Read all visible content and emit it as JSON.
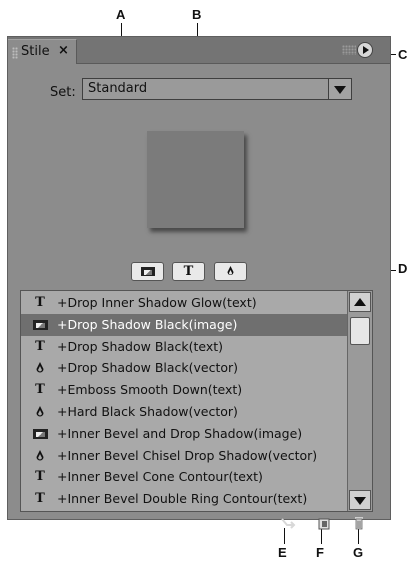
{
  "callouts": {
    "a": "A",
    "b": "B",
    "c": "C",
    "d": "D",
    "e": "E",
    "f": "F",
    "g": "G"
  },
  "panel": {
    "tab_title": "Stile",
    "tab_close": "×",
    "menu_icon": "panel-menu-icon"
  },
  "set": {
    "label": "Set:",
    "value": "Standard"
  },
  "filter_buttons": [
    {
      "icon": "image-filter-icon"
    },
    {
      "icon": "text-filter-icon",
      "glyph": "T"
    },
    {
      "icon": "vector-filter-icon"
    }
  ],
  "styles_list": [
    {
      "type": "text",
      "glyph": "T",
      "label": "+Drop Inner Shadow Glow(text)",
      "selected": false
    },
    {
      "type": "image",
      "label": "+Drop Shadow Black(image)",
      "selected": true
    },
    {
      "type": "text",
      "glyph": "T",
      "label": "+Drop Shadow Black(text)",
      "selected": false
    },
    {
      "type": "vector",
      "label": "+Drop Shadow Black(vector)",
      "selected": false
    },
    {
      "type": "text",
      "glyph": "T",
      "label": "+Emboss Smooth Down(text)",
      "selected": false
    },
    {
      "type": "vector",
      "label": "+Hard Black Shadow(vector)",
      "selected": false
    },
    {
      "type": "image",
      "label": "+Inner Bevel and Drop Shadow(image)",
      "selected": false
    },
    {
      "type": "vector",
      "label": "+Inner Bevel Chisel Drop Shadow(vector)",
      "selected": false
    },
    {
      "type": "text",
      "glyph": "T",
      "label": "+Inner Bevel Cone Contour(text)",
      "selected": false
    },
    {
      "type": "text",
      "glyph": "T",
      "label": "+Inner Bevel Double Ring Contour(text)",
      "selected": false
    }
  ],
  "bottom_icons": [
    "apply-style-icon",
    "new-style-icon",
    "delete-style-icon"
  ],
  "colors": {
    "panel_bg": "#8c8c8c",
    "list_bg": "#a9a9a9",
    "selected_row": "#6f6f6f"
  }
}
